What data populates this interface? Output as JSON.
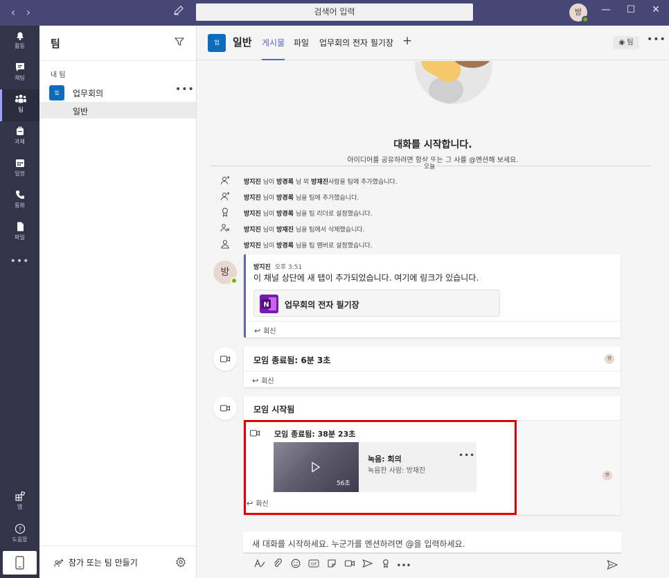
{
  "window": {
    "search_placeholder": "검색어 입력",
    "avatar_initial": "방"
  },
  "rail": {
    "items": [
      {
        "label": "활동"
      },
      {
        "label": "채팅"
      },
      {
        "label": "팀"
      },
      {
        "label": "과제"
      },
      {
        "label": "일정"
      },
      {
        "label": "통화"
      },
      {
        "label": "파일"
      }
    ],
    "more": "•••",
    "apps_label": "앱",
    "help_label": "도움말"
  },
  "teams_panel": {
    "title": "팀",
    "section": "내 팀",
    "team": {
      "badge": "업",
      "name": "업무회의",
      "more": "•••"
    },
    "channel": "일반",
    "join_label": "참가 또는 팀 만들기"
  },
  "header": {
    "badge": "업",
    "channel_name": "일반",
    "tabs": [
      "게시물",
      "파일",
      "업무회의 전자 필기장"
    ],
    "add_tab": "+",
    "team_button": "팀",
    "more": "•••"
  },
  "conversation": {
    "start_title": "대화를 시작합니다.",
    "start_sub": "아이디어를 공유하려면 항상 또는 그 사를 @멘션해 보세요.",
    "today": "오늘",
    "system_messages": [
      {
        "actor": "방지진",
        "mid": " 님이 ",
        "target": "방경록",
        "mid2": " 님 외 ",
        "target2": "방재진",
        "rest": "사람을 팀에 추가했습니다."
      },
      {
        "actor": "방지진",
        "mid": " 님이 ",
        "target": "방경록",
        "mid2": "",
        "target2": "",
        "rest": " 님을 팀에 추가했습니다."
      },
      {
        "actor": "방지진",
        "mid": " 님이 ",
        "target": "방경록",
        "mid2": "",
        "target2": "",
        "rest": " 님을 팀 리더로 설정했습니다."
      },
      {
        "actor": "방지진",
        "mid": " 님이 ",
        "target": "방재진",
        "mid2": "",
        "target2": "",
        "rest": " 님을 팀에서 삭제했습니다."
      },
      {
        "actor": "방지진",
        "mid": " 님이 ",
        "target": "방경록",
        "mid2": "",
        "target2": "",
        "rest": " 님을 팀 멤버로 설정했습니다."
      }
    ],
    "post": {
      "avatar": "방",
      "author": "방지진",
      "time": "오후 3:51",
      "text": "이 채널 상단에 새 탭이 추가되었습니다. 여기에 링크가 있습니다.",
      "attachment": "업무회의 전자 필기장",
      "reply": "회신"
    },
    "meeting1": {
      "title": "모임 종료됨: 6분 3초",
      "avatar": "방",
      "reply": "회신"
    },
    "meeting2": {
      "title": "모임 시작됨",
      "ended": "모임 종료됨: 38분 23초",
      "recording_title": "녹음: 회의",
      "recording_by": "녹음한 사람: 방재진",
      "duration": "56초",
      "more": "•••",
      "avatar": "방",
      "reply": "회신"
    }
  },
  "compose": {
    "placeholder": "새 대화를 시작하세요. 누군가를 멘션하려면 @을 입력하세요.",
    "gif": "GIF",
    "more": "•••"
  },
  "colors": {
    "titlebar": "#464775",
    "rail": "#33344a",
    "accent": "#5b5fc7",
    "highlight": "#e00000"
  }
}
